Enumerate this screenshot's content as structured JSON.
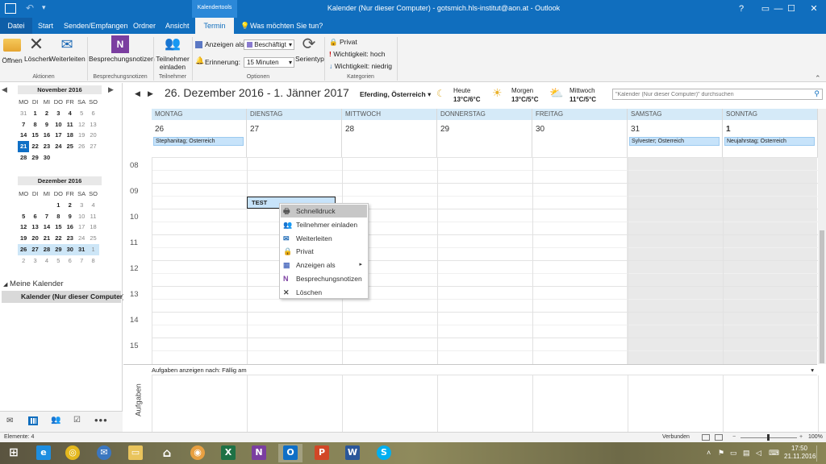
{
  "window": {
    "title": "Kalender (Nur dieser Computer) - gotsmich.hls-institut@aon.at - Outlook",
    "context_tab_group": "Kalendertools",
    "controls": {
      "help": "?",
      "ribbon_options": "▭",
      "minimize": "—",
      "maximize": "☐",
      "close": "✕"
    }
  },
  "tabs": [
    "Datei",
    "Start",
    "Senden/Empfangen",
    "Ordner",
    "Ansicht",
    "Termin"
  ],
  "tell_me": "Was möchten Sie tun?",
  "ribbon": {
    "aktionen": {
      "open": "Öffnen",
      "delete": "Löschen",
      "forward": "Weiterleiten",
      "label": "Aktionen"
    },
    "notizen": {
      "meeting_notes": "Besprechungsnotizen",
      "label": "Besprechungsnotizen"
    },
    "teilnehmer": {
      "invite": "Teilnehmer einladen",
      "label": "Teilnehmer"
    },
    "optionen": {
      "show_as_label": "Anzeigen als:",
      "show_as_value": "Beschäftigt",
      "reminder_label": "Erinnerung:",
      "reminder_value": "15 Minuten",
      "recurrence": "Serientyp",
      "label": "Optionen"
    },
    "kategorien": {
      "private": "Privat",
      "high": "Wichtigkeit: hoch",
      "low": "Wichtigkeit: niedrig",
      "label": "Kategorien"
    }
  },
  "mini_calendars": [
    {
      "title": "November 2016",
      "dow": [
        "MO",
        "DI",
        "MI",
        "DO",
        "FR",
        "SA",
        "SO"
      ],
      "weeks": [
        [
          "31",
          "1",
          "2",
          "3",
          "4",
          "5",
          "6"
        ],
        [
          "7",
          "8",
          "9",
          "10",
          "11",
          "12",
          "13"
        ],
        [
          "14",
          "15",
          "16",
          "17",
          "18",
          "19",
          "20"
        ],
        [
          "21",
          "22",
          "23",
          "24",
          "25",
          "26",
          "27"
        ],
        [
          "28",
          "29",
          "30",
          "",
          "",
          "",
          ""
        ]
      ]
    },
    {
      "title": "Dezember 2016",
      "dow": [
        "MO",
        "DI",
        "MI",
        "DO",
        "FR",
        "SA",
        "SO"
      ],
      "weeks": [
        [
          "",
          "",
          "",
          "1",
          "2",
          "3",
          "4"
        ],
        [
          "5",
          "6",
          "7",
          "8",
          "9",
          "10",
          "11"
        ],
        [
          "12",
          "13",
          "14",
          "15",
          "16",
          "17",
          "18"
        ],
        [
          "19",
          "20",
          "21",
          "22",
          "23",
          "24",
          "25"
        ],
        [
          "26",
          "27",
          "28",
          "29",
          "30",
          "31",
          "1"
        ],
        [
          "2",
          "3",
          "4",
          "5",
          "6",
          "7",
          "8"
        ]
      ]
    }
  ],
  "folders": {
    "heading": "Meine Kalender",
    "item": "Kalender (Nur dieser Computer)"
  },
  "calendar": {
    "range": "26. Dezember 2016 - 1. Jänner 2017",
    "location": "Eferding, Österreich",
    "weather": [
      {
        "label": "Heute",
        "temp": "13°C/6°C"
      },
      {
        "label": "Morgen",
        "temp": "13°C/5°C"
      },
      {
        "label": "Mittwoch",
        "temp": "11°C/5°C"
      }
    ],
    "search_placeholder": "\"Kalender (Nur dieser Computer)\" durchsuchen",
    "days": [
      {
        "name": "MONTAG",
        "num": "26",
        "event": "Stephanitag; Österreich"
      },
      {
        "name": "DIENSTAG",
        "num": "27",
        "event": ""
      },
      {
        "name": "MITTWOCH",
        "num": "28",
        "event": ""
      },
      {
        "name": "DONNERSTAG",
        "num": "29",
        "event": ""
      },
      {
        "name": "FREITAG",
        "num": "30",
        "event": ""
      },
      {
        "name": "SAMSTAG",
        "num": "31",
        "event": "Sylvester; Österreich"
      },
      {
        "name": "SONNTAG",
        "num": "1",
        "event": "Neujahrstag; Österreich"
      }
    ],
    "hours": [
      "08",
      "09",
      "10",
      "11",
      "12",
      "13",
      "14",
      "15"
    ],
    "appointment": "TEST",
    "tasks_bar": "Aufgaben anzeigen nach: Fällig am",
    "tasks_label": "Aufgaben"
  },
  "context_menu": [
    {
      "label": "Schnelldruck",
      "icon": "quick-print-icon"
    },
    {
      "label": "Teilnehmer einladen",
      "icon": "invite-attendees-icon"
    },
    {
      "label": "Weiterleiten",
      "icon": "forward-icon"
    },
    {
      "label": "Privat",
      "icon": "lock-icon"
    },
    {
      "label": "Anzeigen als",
      "icon": "show-as-icon"
    },
    {
      "label": "Besprechungsnotizen",
      "icon": "onenote-icon"
    },
    {
      "label": "Löschen",
      "icon": "delete-icon"
    }
  ],
  "navigation": [
    "mail-icon",
    "calendar-icon",
    "people-icon",
    "tasks-icon",
    "more-icon"
  ],
  "status": {
    "items": "Elemente: 4",
    "connection": "Verbunden",
    "zoom": "100%"
  },
  "taskbar": {
    "time": "17:50",
    "date": "21.11.2016"
  }
}
